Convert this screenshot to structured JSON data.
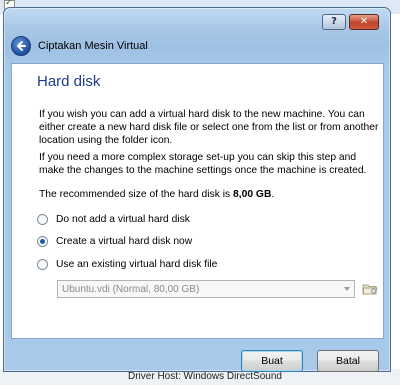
{
  "window": {
    "title": "Ciptakan Mesin Virtual",
    "help_label": "?",
    "close_label": "✕"
  },
  "page": {
    "heading": "Hard disk",
    "paragraph1": "If you wish you can add a virtual hard disk to the new machine. You can either create a new hard disk file or select one from the list or from another location using the folder icon.",
    "paragraph2": "If you need a more complex storage set-up you can skip this step and make the changes to the machine settings once the machine is created.",
    "recommended_prefix": "The recommended size of the hard disk is ",
    "recommended_size": "8,00 GB",
    "recommended_suffix": "."
  },
  "options": [
    {
      "label": "Do not add a virtual hard disk",
      "selected": false
    },
    {
      "label": "Create a virtual hard disk now",
      "selected": true
    },
    {
      "label": "Use an existing virtual hard disk file",
      "selected": false
    }
  ],
  "existing_disk": {
    "selected_value": "Ubuntu.vdi (Normal, 80,00 GB)",
    "enabled": false
  },
  "buttons": {
    "create": "Buat",
    "cancel": "Batal"
  },
  "background": {
    "bottom_text": "Driver Host:    Windows DirectSound"
  }
}
